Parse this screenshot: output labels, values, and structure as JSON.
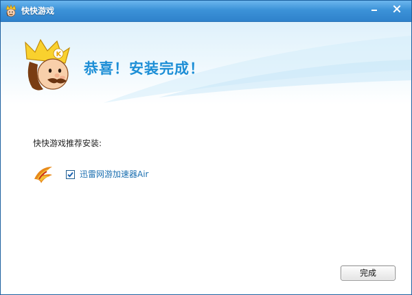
{
  "window": {
    "title": "快快游戏",
    "accent_color": "#3c92d8"
  },
  "header": {
    "message": "恭喜！安装完成！",
    "message_color": "#1c8ed6"
  },
  "recommend": {
    "label": "快快游戏推荐安装:",
    "items": [
      {
        "label": "迅雷网游加速器Air",
        "checked": true,
        "icon": "xunlei-accelerator-icon"
      }
    ]
  },
  "footer": {
    "finish_label": "完成"
  },
  "icons": {
    "app": "king-mascot-icon",
    "minimize": "minimize-icon",
    "close": "close-icon",
    "mascot": "king-mascot-logo"
  }
}
